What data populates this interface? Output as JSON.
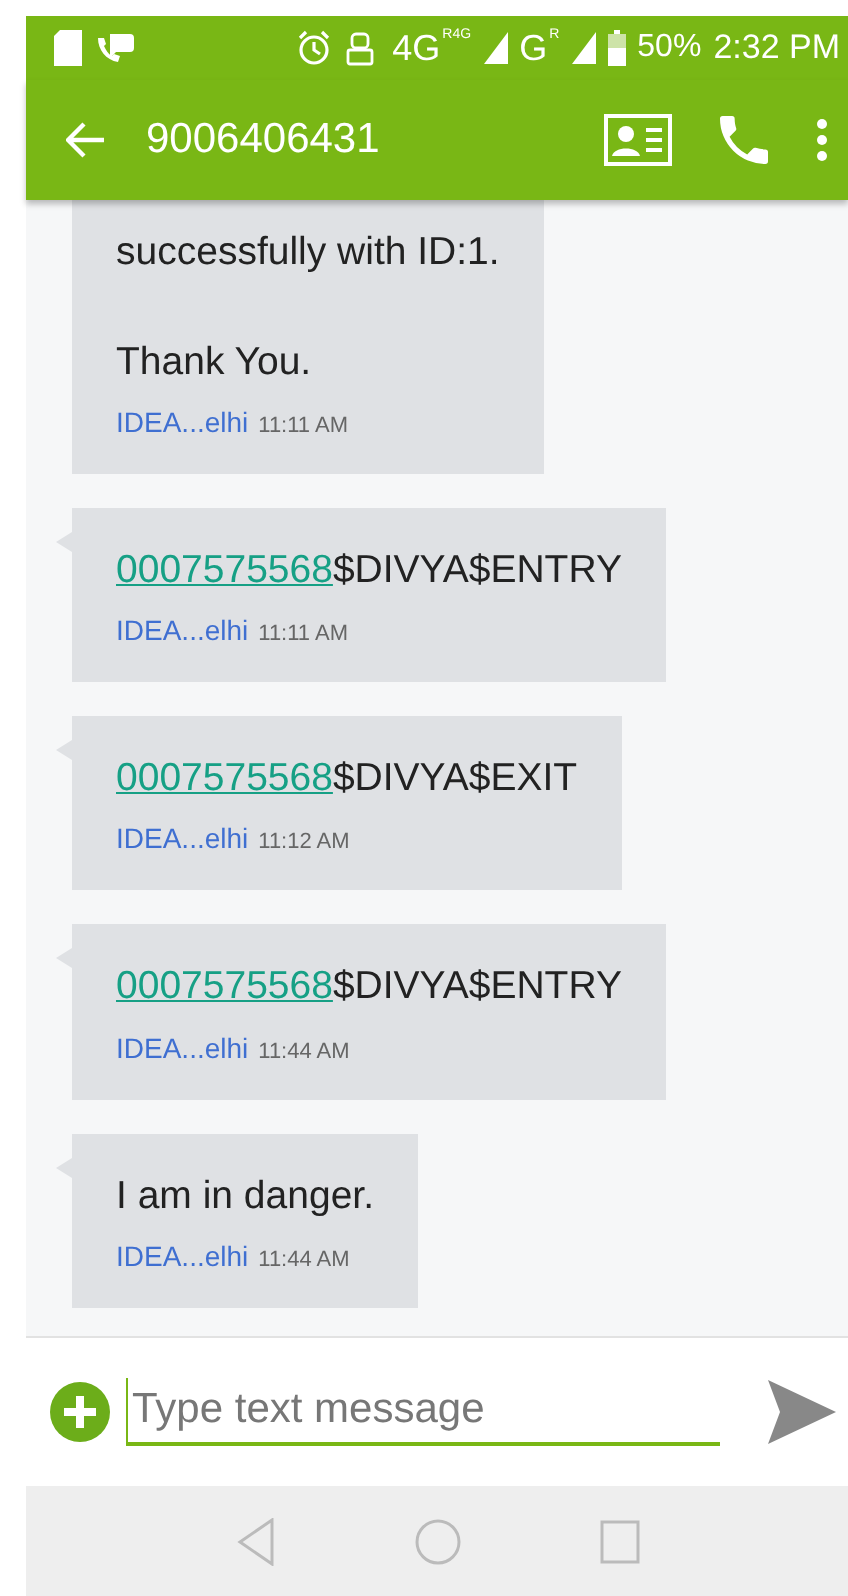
{
  "status_bar": {
    "network_1": "4G",
    "network_1_tag": "R4G",
    "network_2": "G",
    "network_2_tag": "R",
    "battery": "50%",
    "time": "2:32 PM"
  },
  "app_bar": {
    "title": "9006406431"
  },
  "messages": [
    {
      "text": "successfully with ID:1.\n\nThank You.",
      "sender": "IDEA...elhi",
      "time": "11:11 AM"
    },
    {
      "tail": true,
      "link": "0007575568",
      "text": "$DIVYA$ENTRY",
      "sender": "IDEA...elhi",
      "time": "11:11 AM"
    },
    {
      "tail": true,
      "link": "0007575568",
      "text": "$DIVYA$EXIT",
      "sender": "IDEA...elhi",
      "time": "11:12 AM"
    },
    {
      "tail": true,
      "link": "0007575568",
      "text": "$DIVYA$ENTRY",
      "sender": "IDEA...elhi",
      "time": "11:44 AM"
    },
    {
      "tail": true,
      "text": "I am in danger.",
      "sender": "IDEA...elhi",
      "time": "11:44 AM"
    }
  ],
  "composer": {
    "placeholder": "Type text message"
  }
}
